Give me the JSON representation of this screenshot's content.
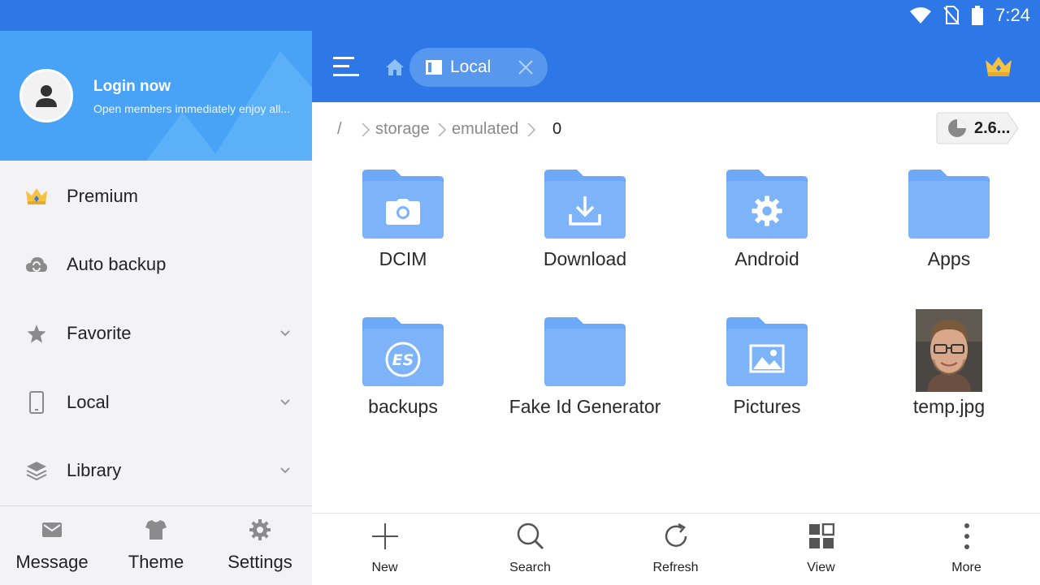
{
  "status_bar": {
    "time": "7:24"
  },
  "drawer": {
    "header": {
      "title": "Login now",
      "subtitle": "Open members immediately enjoy all..."
    },
    "items": [
      {
        "label": "Premium",
        "icon": "crown-icon",
        "expandable": false
      },
      {
        "label": "Auto backup",
        "icon": "cloud-sync-icon",
        "expandable": false
      },
      {
        "label": "Favorite",
        "icon": "star-icon",
        "expandable": true
      },
      {
        "label": "Local",
        "icon": "phone-icon",
        "expandable": true
      },
      {
        "label": "Library",
        "icon": "layers-icon",
        "expandable": true
      }
    ],
    "footer": [
      {
        "label": "Message",
        "icon": "mail-icon"
      },
      {
        "label": "Theme",
        "icon": "tshirt-icon"
      },
      {
        "label": "Settings",
        "icon": "gear-icon"
      }
    ]
  },
  "toolbar": {
    "tab_label": "Local"
  },
  "breadcrumb": {
    "root": "/",
    "parts": [
      "storage",
      "emulated",
      "0"
    ],
    "storage_label": "2.6..."
  },
  "files": [
    {
      "name": "DCIM",
      "icon": "camera-icon"
    },
    {
      "name": "Download",
      "icon": "download-icon"
    },
    {
      "name": "Android",
      "icon": "gear-icon"
    },
    {
      "name": "Apps",
      "icon": "folder-icon"
    },
    {
      "name": "backups",
      "icon": "es-logo-icon"
    },
    {
      "name": "Fake Id Generator",
      "icon": "folder-icon"
    },
    {
      "name": "Pictures",
      "icon": "image-icon"
    },
    {
      "name": "temp.jpg",
      "icon": "photo-thumbnail"
    }
  ],
  "bottom_bar": [
    {
      "label": "New",
      "icon": "plus-icon"
    },
    {
      "label": "Search",
      "icon": "search-icon"
    },
    {
      "label": "Refresh",
      "icon": "refresh-icon"
    },
    {
      "label": "View",
      "icon": "grid-view-icon"
    },
    {
      "label": "More",
      "icon": "more-vertical-icon"
    }
  ],
  "colors": {
    "primary_blue": "#2d77e6",
    "drawer_header": "#48a3f6",
    "folder_blue": "#6ea9f7",
    "drawer_bg": "#f3f3f5"
  }
}
